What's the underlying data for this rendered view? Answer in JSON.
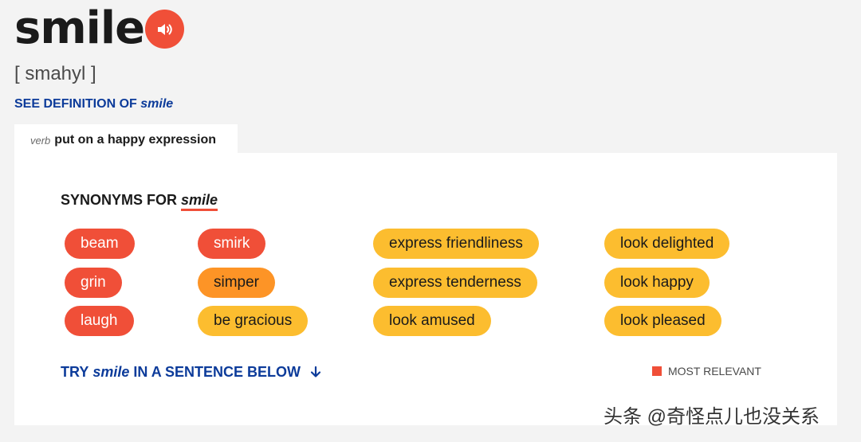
{
  "entry": {
    "word": "smile",
    "pronunciation": "[ smahyl ]",
    "see_definition_prefix": "SEE DEFINITION OF",
    "see_definition_word": "smile",
    "audio_icon": "speaker-icon"
  },
  "tab": {
    "part_of_speech": "verb",
    "sense": "put on a happy expression"
  },
  "synonyms": {
    "heading_prefix": "SYNONYMS FOR",
    "heading_word": "smile",
    "columns": [
      [
        {
          "label": "beam",
          "relevance": "most"
        },
        {
          "label": "grin",
          "relevance": "most"
        },
        {
          "label": "laugh",
          "relevance": "most"
        }
      ],
      [
        {
          "label": "smirk",
          "relevance": "most"
        },
        {
          "label": "simper",
          "relevance": "medium"
        },
        {
          "label": "be gracious",
          "relevance": "less"
        }
      ],
      [
        {
          "label": "express friendliness",
          "relevance": "less"
        },
        {
          "label": "express tenderness",
          "relevance": "less"
        },
        {
          "label": "look amused",
          "relevance": "less"
        }
      ],
      [
        {
          "label": "look delighted",
          "relevance": "less"
        },
        {
          "label": "look happy",
          "relevance": "less"
        },
        {
          "label": "look pleased",
          "relevance": "less"
        }
      ]
    ]
  },
  "try_sentence": {
    "prefix": "TRY",
    "word": "smile",
    "suffix": "IN A SENTENCE BELOW",
    "arrow_icon": "arrow-down-icon"
  },
  "legend": {
    "label": "MOST RELEVANT",
    "color": "#f04f38"
  },
  "colors": {
    "most": "#f04f38",
    "medium": "#fd9426",
    "less": "#fcbd2f",
    "link": "#0c3b9a"
  },
  "watermark": "头条 @奇怪点儿也没关系"
}
